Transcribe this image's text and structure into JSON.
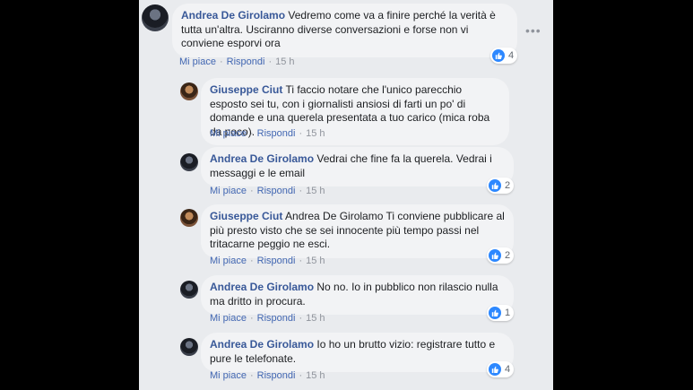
{
  "comments": [
    {
      "author": "Andrea De Girolamo",
      "text": "Vedremo come va a finire perché la verità è tutta un'altra. Usciranno diverse conversazioni e forse non vi conviene esporvi ora",
      "like": "Mi piace",
      "reply": "Rispondi",
      "time": "15 h",
      "reactions": "4"
    },
    {
      "author": "Giuseppe Ciut",
      "text": "Ti faccio notare che l'unico parecchio esposto sei tu, con i giornalisti ansiosi di farti un po' di domande e una querela presentata a tuo carico (mica roba da poco).",
      "like": "Mi piace",
      "reply": "Rispondi",
      "time": "15 h",
      "reactions": ""
    },
    {
      "author": "Andrea De Girolamo",
      "text": "Vedrai che fine fa la querela. Vedrai i messaggi e le email",
      "like": "Mi piace",
      "reply": "Rispondi",
      "time": "15 h",
      "reactions": "2"
    },
    {
      "author": "Giuseppe Ciut",
      "text": "Andrea De Girolamo Ti conviene pubblicare al più presto visto che se sei innocente più tempo passi nel tritacarne peggio ne esci.",
      "like": "Mi piace",
      "reply": "Rispondi",
      "time": "15 h",
      "reactions": "2"
    },
    {
      "author": "Andrea De Girolamo",
      "text": "No no. Io in pubblico non rilascio nulla ma dritto in procura.",
      "like": "Mi piace",
      "reply": "Rispondi",
      "time": "15 h",
      "reactions": "1"
    },
    {
      "author": "Andrea De Girolamo",
      "text": "Io ho un brutto vizio: registrare tutto e pure le telefonate.",
      "like": "Mi piace",
      "reply": "Rispondi",
      "time": "15 h",
      "reactions": "4"
    }
  ],
  "icons": {
    "like": "like-icon",
    "more": "more-options-icon"
  },
  "colors": {
    "name": "#385898",
    "link": "#4267b2",
    "bubble": "#f2f3f5",
    "like_badge": "#2d88ff"
  }
}
